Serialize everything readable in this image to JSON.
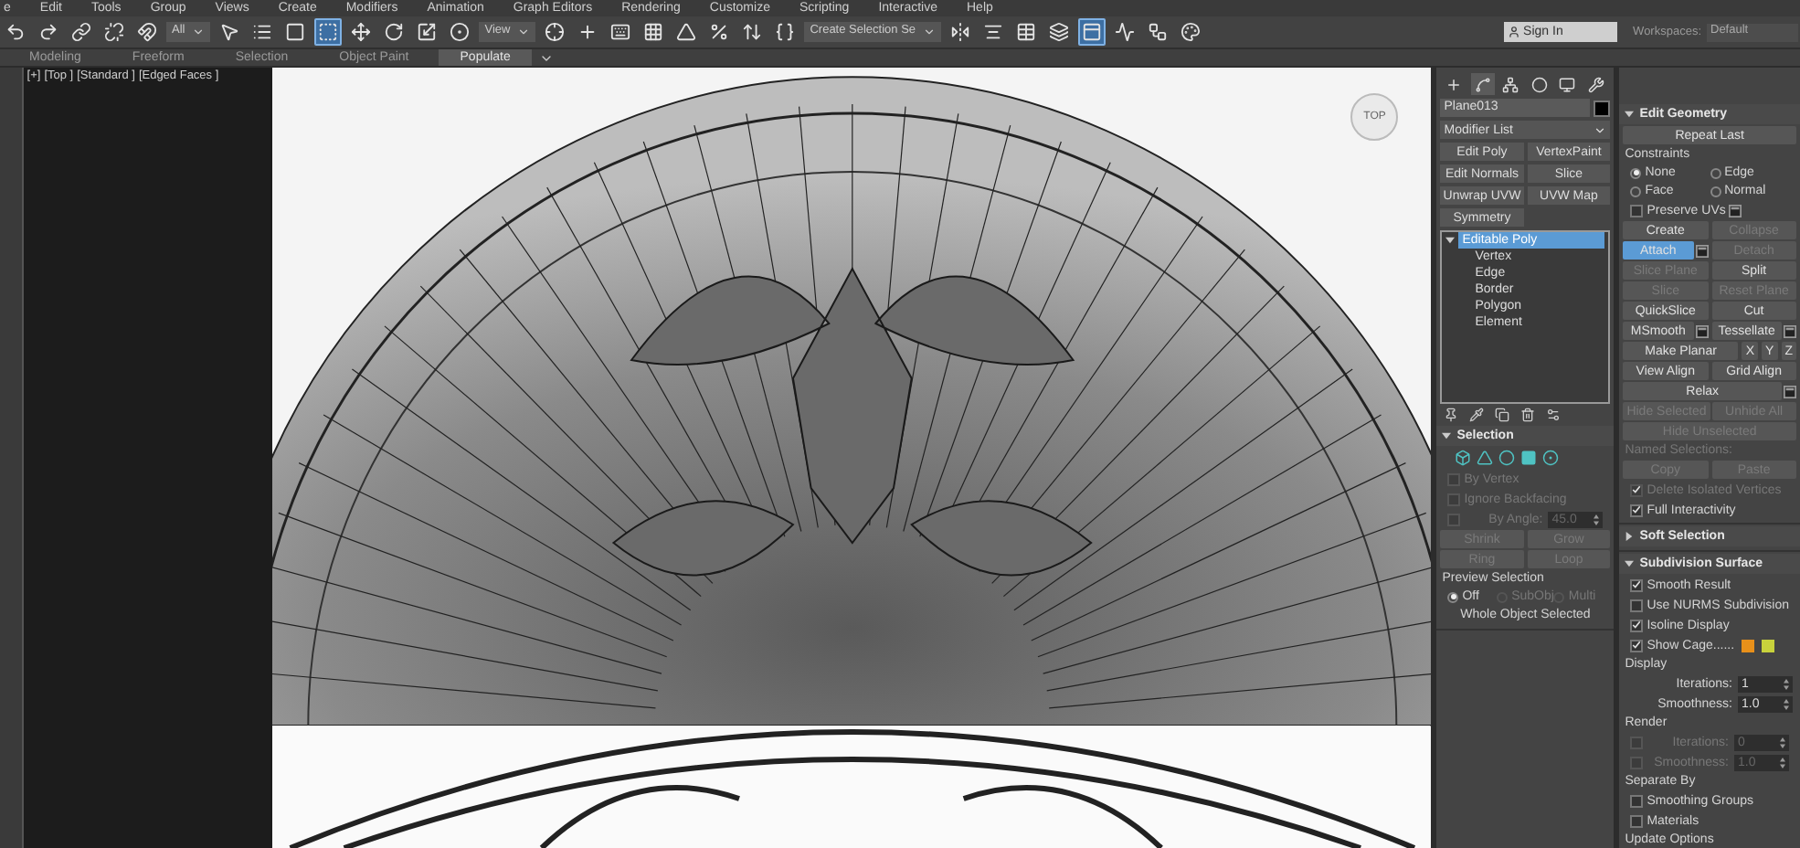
{
  "menu_bar": [
    "e",
    "Edit",
    "Tools",
    "Group",
    "Views",
    "Create",
    "Modifiers",
    "Animation",
    "Graph Editors",
    "Rendering",
    "Customize",
    "Scripting",
    "Interactive",
    "Help"
  ],
  "toolbar": {
    "items": [
      {
        "kind": "undo",
        "selected": false
      },
      {
        "kind": "redo",
        "selected": false
      },
      {
        "kind": "link",
        "selected": false
      },
      {
        "kind": "unlink",
        "selected": false
      },
      {
        "kind": "bind",
        "selected": false
      },
      {
        "kind": "dropdown",
        "label": "All"
      },
      {
        "kind": "select",
        "selected": false
      },
      {
        "kind": "select_by_name",
        "selected": false
      },
      {
        "kind": "region",
        "selected": false
      },
      {
        "kind": "crossing",
        "selected": true
      },
      {
        "kind": "move",
        "selected": false
      },
      {
        "kind": "rotate",
        "selected": false
      },
      {
        "kind": "scale",
        "selected": false
      },
      {
        "kind": "place",
        "selected": false
      },
      {
        "kind": "dropdown",
        "label": "View"
      },
      {
        "kind": "pivot",
        "selected": false
      },
      {
        "kind": "manipulate",
        "selected": false
      },
      {
        "kind": "keyboard",
        "selected": false
      },
      {
        "kind": "snap",
        "selected": false
      },
      {
        "kind": "angle_snap",
        "selected": false
      },
      {
        "kind": "percent_snap",
        "selected": false
      },
      {
        "kind": "spinner_snap",
        "selected": false
      },
      {
        "kind": "named_sets",
        "selected": false
      },
      {
        "kind": "dropdown",
        "label": "Create Selection Se"
      },
      {
        "kind": "mirror",
        "selected": false
      },
      {
        "kind": "align",
        "selected": false
      },
      {
        "kind": "explorer",
        "selected": false
      },
      {
        "kind": "layers",
        "selected": false
      },
      {
        "kind": "ribbon",
        "selected": true
      },
      {
        "kind": "curve_editor",
        "selected": false
      },
      {
        "kind": "schematic",
        "selected": false
      },
      {
        "kind": "material",
        "selected": false
      }
    ],
    "sign_in": "Sign In",
    "workspaces_label": "Workspaces:",
    "workspace": "Default"
  },
  "ribbon_tabs": [
    {
      "label": "Modeling",
      "selected": false
    },
    {
      "label": "Freeform",
      "selected": false
    },
    {
      "label": "Selection",
      "selected": false
    },
    {
      "label": "Object Paint",
      "selected": false
    },
    {
      "label": "Populate",
      "selected": true
    }
  ],
  "viewport": {
    "labels": [
      "[+]",
      "[Top ]",
      "[Standard ]",
      "[Edged Faces ]"
    ],
    "viewcube": "TOP"
  },
  "command_panel": {
    "tabs": [
      {
        "kind": "create",
        "selected": false
      },
      {
        "kind": "modify",
        "selected": true
      },
      {
        "kind": "hierarchy",
        "selected": false
      },
      {
        "kind": "motion",
        "selected": false
      },
      {
        "kind": "display",
        "selected": false
      },
      {
        "kind": "utilities",
        "selected": false
      }
    ],
    "object_name": "Plane013",
    "modifier_list": "Modifier List",
    "modifier_buttons": [
      "Edit Poly",
      "VertexPaint",
      "Edit Normals",
      "Slice",
      "Unwrap UVW",
      "UVW Map",
      "Symmetry"
    ],
    "stack": [
      {
        "label": "Editable Poly",
        "selected": true,
        "expanded": true,
        "children": [
          {
            "label": "Vertex",
            "selected": false
          },
          {
            "label": "Edge",
            "selected": false
          },
          {
            "label": "Border",
            "selected": false
          },
          {
            "label": "Polygon",
            "selected": false
          },
          {
            "label": "Element",
            "selected": false
          }
        ]
      }
    ],
    "selection": {
      "title": "Selection",
      "expanded": true,
      "items": [
        {
          "kind": "check",
          "label": "By Vertex",
          "checked": false,
          "disabled": true
        },
        {
          "kind": "check",
          "label": "Ignore Backfacing",
          "checked": false,
          "disabled": true
        },
        {
          "kind": "check_spinner",
          "label": "By Angle:",
          "value": "45.0",
          "checked": false,
          "disabled": true
        },
        {
          "kind": "buttons",
          "buttons": [
            {
              "label": "Shrink",
              "disabled": true
            },
            {
              "label": "Grow",
              "disabled": true
            }
          ]
        },
        {
          "kind": "buttons",
          "buttons": [
            {
              "label": "Ring",
              "disabled": true
            },
            {
              "label": "Loop",
              "disabled": true
            }
          ]
        },
        {
          "kind": "label",
          "label": "Preview Selection"
        },
        {
          "kind": "radios",
          "options": [
            {
              "label": "Off",
              "selected": true,
              "disabled": false
            },
            {
              "label": "SubObj",
              "selected": false,
              "disabled": true
            },
            {
              "label": "Multi",
              "selected": false,
              "disabled": true
            }
          ]
        },
        {
          "kind": "status",
          "label": "Whole Object Selected"
        }
      ]
    }
  },
  "edit_geometry": {
    "title": "Edit Geometry",
    "expanded": true,
    "items": [
      {
        "kind": "buttons",
        "buttons": [
          {
            "label": "Repeat Last",
            "disabled": false
          }
        ]
      },
      {
        "kind": "label",
        "label": "Constraints"
      },
      {
        "kind": "radios",
        "options": [
          {
            "label": "None",
            "selected": true,
            "disabled": false
          },
          {
            "label": "Edge",
            "selected": false,
            "disabled": false
          }
        ]
      },
      {
        "kind": "radios",
        "options": [
          {
            "label": "Face",
            "selected": false,
            "disabled": false
          },
          {
            "label": "Normal",
            "selected": false,
            "disabled": false
          }
        ]
      },
      {
        "kind": "check",
        "label": "Preserve UVs",
        "checked": false,
        "disabled": false,
        "settings": true
      },
      {
        "kind": "buttons",
        "buttons": [
          {
            "label": "Create",
            "disabled": false
          },
          {
            "label": "Collapse",
            "disabled": true
          }
        ]
      },
      {
        "kind": "buttons",
        "buttons": [
          {
            "label": "Attach",
            "disabled": false,
            "selected": true,
            "settings": true
          },
          {
            "label": "Detach",
            "disabled": true
          }
        ]
      },
      {
        "kind": "buttons",
        "buttons": [
          {
            "label": "Slice Plane",
            "disabled": true
          },
          {
            "label": "Split",
            "disabled": false
          }
        ]
      },
      {
        "kind": "buttons",
        "buttons": [
          {
            "label": "Slice",
            "disabled": true
          },
          {
            "label": "Reset Plane",
            "disabled": true
          }
        ]
      },
      {
        "kind": "buttons",
        "buttons": [
          {
            "label": "QuickSlice",
            "disabled": false
          },
          {
            "label": "Cut",
            "disabled": false
          }
        ]
      },
      {
        "kind": "buttons",
        "buttons": [
          {
            "label": "MSmooth",
            "disabled": false,
            "settings": true
          },
          {
            "label": "Tessellate",
            "disabled": false,
            "settings": true
          }
        ]
      },
      {
        "kind": "buttons",
        "buttons": [
          {
            "label": "Make Planar",
            "disabled": false
          },
          {
            "label": "X",
            "disabled": false
          },
          {
            "label": "Y",
            "disabled": false
          },
          {
            "label": "Z",
            "disabled": false
          }
        ]
      },
      {
        "kind": "buttons",
        "buttons": [
          {
            "label": "View Align",
            "disabled": false
          },
          {
            "label": "Grid Align",
            "disabled": false
          }
        ]
      },
      {
        "kind": "buttons",
        "buttons": [
          {
            "label": "Relax",
            "disabled": false,
            "settings": true
          }
        ]
      },
      {
        "kind": "buttons",
        "buttons": [
          {
            "label": "Hide Selected",
            "disabled": true
          },
          {
            "label": "Unhide All",
            "disabled": true
          }
        ]
      },
      {
        "kind": "buttons",
        "buttons": [
          {
            "label": "Hide Unselected",
            "disabled": true
          }
        ]
      },
      {
        "kind": "label",
        "label": "Named Selections:",
        "disabled": true
      },
      {
        "kind": "buttons",
        "buttons": [
          {
            "label": "Copy",
            "disabled": true
          },
          {
            "label": "Paste",
            "disabled": true
          }
        ]
      },
      {
        "kind": "check",
        "label": "Delete Isolated Vertices",
        "checked": true,
        "disabled": true
      },
      {
        "kind": "check",
        "label": "Full Interactivity",
        "checked": true,
        "disabled": false
      }
    ]
  },
  "soft_selection": {
    "title": "Soft Selection",
    "expanded": false
  },
  "subdivision_surface": {
    "title": "Subdivision Surface",
    "expanded": true,
    "items": [
      {
        "kind": "check",
        "label": "Smooth Result",
        "checked": true,
        "disabled": false
      },
      {
        "kind": "check",
        "label": "Use NURMS Subdivision",
        "checked": false,
        "disabled": false
      },
      {
        "kind": "check",
        "label": "Isoline Display",
        "checked": true,
        "disabled": false
      },
      {
        "kind": "check",
        "label": "Show Cage......",
        "checked": true,
        "disabled": false,
        "swatches": [
          {
            "color": "#e8901a"
          },
          {
            "color": "#c8d23c"
          }
        ]
      },
      {
        "kind": "label",
        "label": "Display"
      },
      {
        "kind": "spinner",
        "label": "Iterations:",
        "value": "1",
        "disabled": false
      },
      {
        "kind": "spinner",
        "label": "Smoothness:",
        "value": "1.0",
        "disabled": false
      },
      {
        "kind": "label",
        "label": "Render"
      },
      {
        "kind": "check_spinner",
        "label": "Iterations:",
        "value": "0",
        "checked": false,
        "disabled": true
      },
      {
        "kind": "check_spinner",
        "label": "Smoothness:",
        "value": "1.0",
        "checked": false,
        "disabled": true
      },
      {
        "kind": "label",
        "label": "Separate By"
      },
      {
        "kind": "check",
        "label": "Smoothing Groups",
        "checked": false,
        "disabled": false
      },
      {
        "kind": "check",
        "label": "Materials",
        "checked": false,
        "disabled": false
      },
      {
        "kind": "label",
        "label": "Update Options"
      }
    ]
  }
}
